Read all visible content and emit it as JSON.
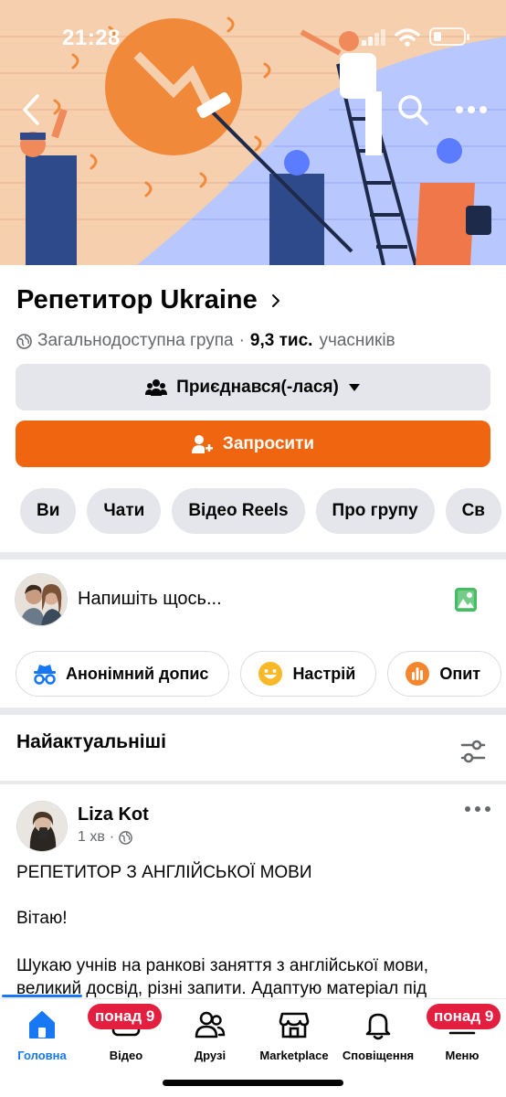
{
  "status_bar": {
    "time": "21:28"
  },
  "group": {
    "name": "Репетитор Ukraine",
    "privacy": "Загальнодоступна група",
    "separator": "·",
    "members_count": "9,3 тис.",
    "members_label": "учасників"
  },
  "buttons": {
    "joined": "Приєднався(-лася)",
    "invite": "Запросити"
  },
  "tabs": [
    "Ви",
    "Чати",
    "Відео Reels",
    "Про групу",
    "Св"
  ],
  "composer": {
    "placeholder": "Напишіть щось..."
  },
  "actions": [
    {
      "label": "Анонімний допис",
      "icon": "anonymous-icon"
    },
    {
      "label": "Настрій",
      "icon": "smile-icon"
    },
    {
      "label": "Опит",
      "icon": "poll-icon"
    }
  ],
  "feed": {
    "sort_label": "Найактуальніші"
  },
  "post": {
    "author": "Liza Kot",
    "time": "1 хв",
    "separator": "·",
    "lines": [
      "РЕПЕТИТОР З АНГЛІЙСЬКОЇ МОВИ",
      "Вітаю!",
      "Шукаю учнів на ранкові заняття з англійської мови,",
      "великий досвід, різні запити. Адаптую матеріал під"
    ]
  },
  "bottom_nav": [
    {
      "label": "Головна",
      "icon": "home-icon",
      "active": true,
      "badge": ""
    },
    {
      "label": "Відео",
      "icon": "video-icon",
      "active": false,
      "badge": "понад 9"
    },
    {
      "label": "Друзі",
      "icon": "friends-icon",
      "active": false,
      "badge": ""
    },
    {
      "label": "Marketplace",
      "icon": "marketplace-icon",
      "active": false,
      "badge": ""
    },
    {
      "label": "Сповіщення",
      "icon": "bell-icon",
      "active": false,
      "badge": ""
    },
    {
      "label": "Меню",
      "icon": "menu-icon",
      "active": false,
      "badge": "понад 9"
    }
  ],
  "colors": {
    "accent": "#f0650f",
    "active_tab": "#1877f2",
    "badge": "#e41e3f",
    "secondary_text": "#65676b"
  }
}
